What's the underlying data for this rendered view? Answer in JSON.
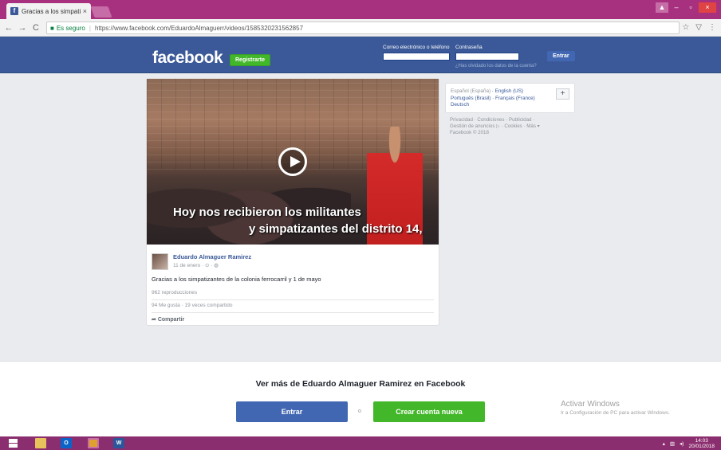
{
  "browser": {
    "tab_title": "Gracias a los simpatizant",
    "tab_close": "×",
    "secure_label": "Es seguro",
    "url": "https://www.facebook.com/EduardoAlmaguerr/videos/1585320231562857",
    "window_user": "▲",
    "window_minimize": "–",
    "window_maximize": "▫",
    "window_close": "×"
  },
  "header": {
    "logo": "facebook",
    "register_button": "Registrarte",
    "email_label": "Correo electrónico o teléfono",
    "password_label": "Contraseña",
    "forgot_link": "¿Has olvidado los datos de la cuenta?",
    "login_button": "Entrar"
  },
  "video": {
    "caption_line1": "Hoy nos recibieron los militantes",
    "caption_line2": "y simpatizantes del distrito 14,",
    "author": "Eduardo Almaguer Ramirez",
    "date": "11 de enero · ⊙ · ◍",
    "post_text": "Gracias a los simpatizantes de la colonia ferrocarril y 1 de mayo",
    "views": "962 reproducciones",
    "stats": "94 Me gusta · 19 veces compartido",
    "share": "Compartir"
  },
  "languages": {
    "current": "Español (España)",
    "links": [
      "English (US)",
      "Português (Brasil)",
      "Français (France)",
      "Deutsch"
    ],
    "plus": "+"
  },
  "footer_links": {
    "line1": "Privacidad · Condiciones · Publicidad ·",
    "line2": "Gestión de anuncios ▷ · Cookies · Más ▾",
    "line3": "Facebook © 2018"
  },
  "banner": {
    "title": "Ver más de Eduardo Almaguer Ramirez en Facebook",
    "login_button": "Entrar",
    "or": "o",
    "create_button": "Crear cuenta nueva",
    "activate_title": "Activar Windows",
    "activate_sub": "Ir a Configuración de PC para activar Windows."
  },
  "taskbar": {
    "outlook": "O",
    "word": "W",
    "time": "14:03",
    "date": "20/01/2018"
  },
  "colors": {
    "fb_blue": "#3b5998",
    "fb_green": "#42b72a",
    "chrome_accent": "#a8317f"
  }
}
